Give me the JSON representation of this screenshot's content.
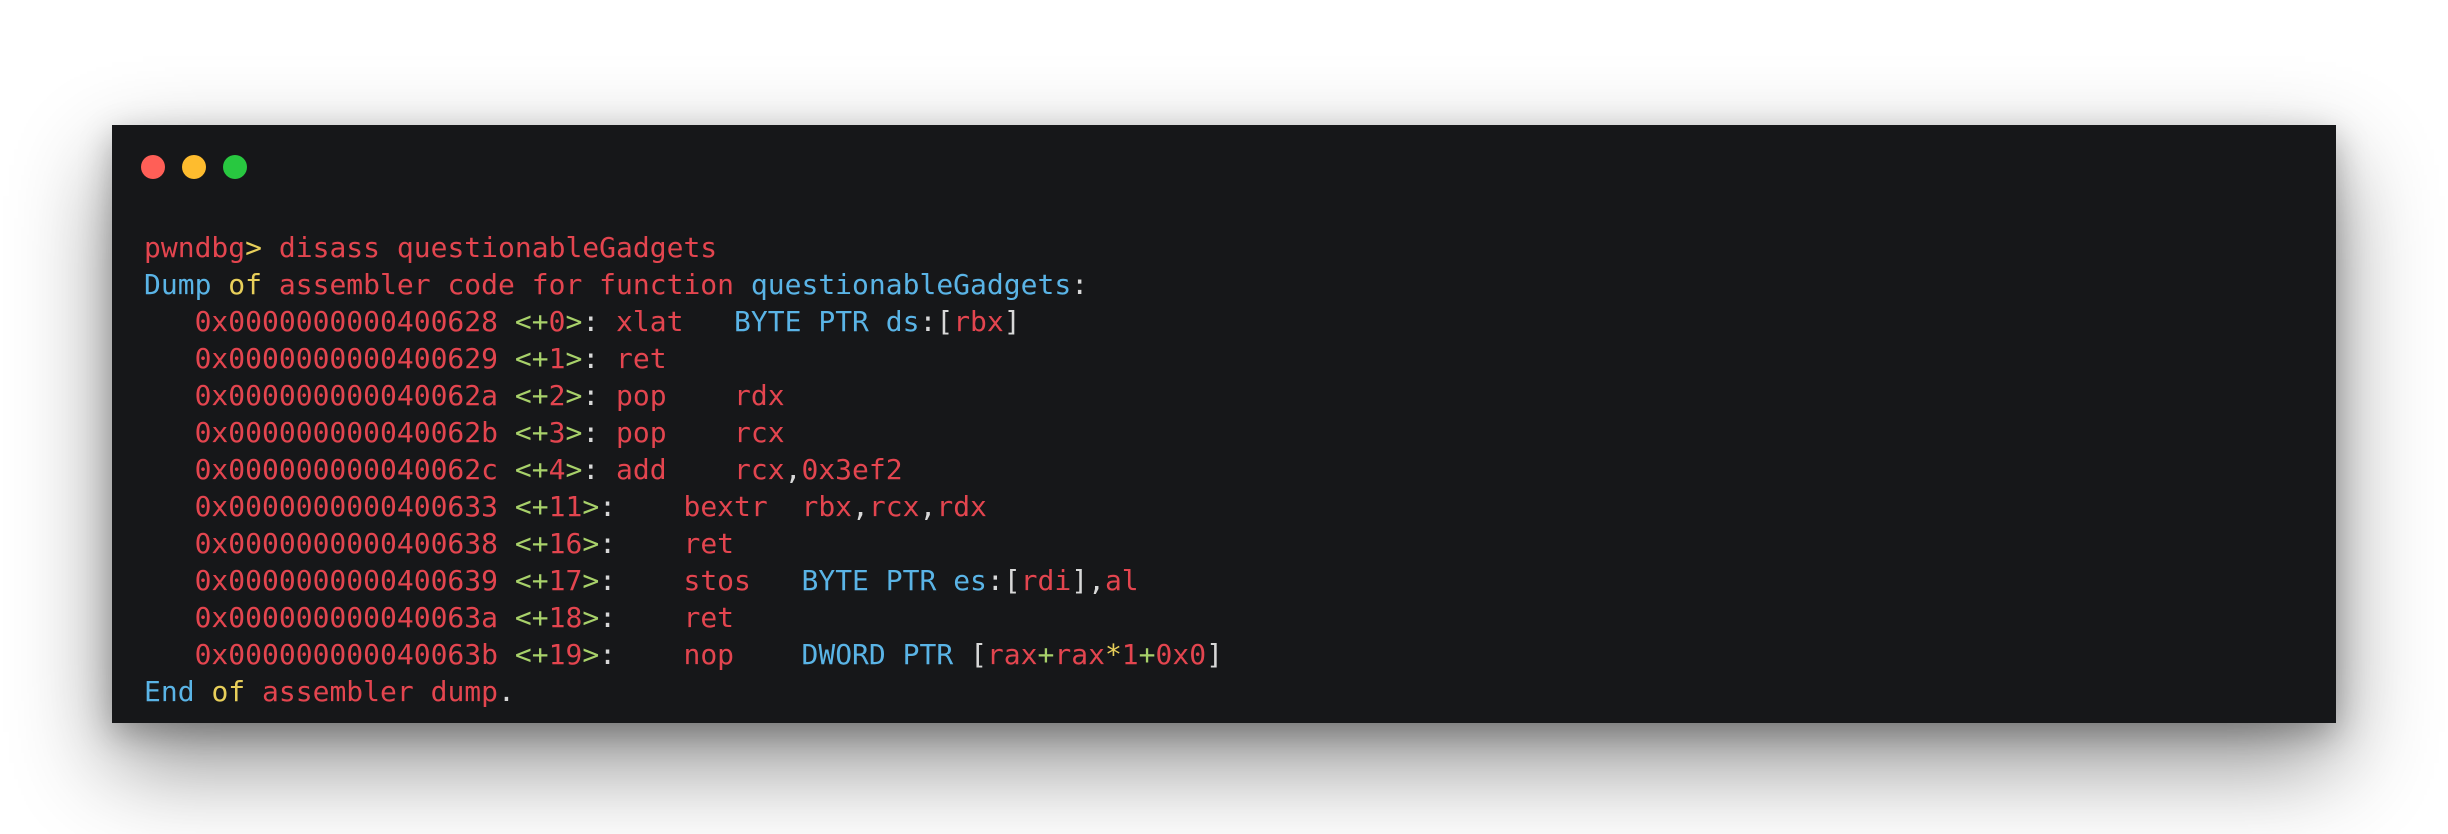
{
  "window": {
    "controls": [
      "close",
      "minimize",
      "zoom"
    ]
  },
  "colors": {
    "background": "#161719",
    "red": "#e3454f",
    "blue": "#5ab4e6",
    "yellow": "#e8cf5a",
    "green": "#a8d16a",
    "white": "#d8d8d8"
  },
  "terminal": {
    "lines": [
      [
        {
          "t": "pwndbg",
          "c": "red"
        },
        {
          "t": "> ",
          "c": "yellow"
        },
        {
          "t": "disass questionableGadgets",
          "c": "red"
        }
      ],
      [
        {
          "t": "Dump ",
          "c": "blue"
        },
        {
          "t": "of ",
          "c": "yellow"
        },
        {
          "t": "assembler code for function ",
          "c": "red"
        },
        {
          "t": "questionableGadgets",
          "c": "blue"
        },
        {
          "t": ":",
          "c": "white"
        }
      ],
      [
        {
          "t": "   0x0000000000400628 ",
          "c": "red"
        },
        {
          "t": "<+",
          "c": "green"
        },
        {
          "t": "0",
          "c": "red"
        },
        {
          "t": ">",
          "c": "green"
        },
        {
          "t": ": ",
          "c": "white"
        },
        {
          "t": "xlat   ",
          "c": "red"
        },
        {
          "t": "BYTE PTR ds",
          "c": "blue"
        },
        {
          "t": ":[",
          "c": "white"
        },
        {
          "t": "rbx",
          "c": "red"
        },
        {
          "t": "]",
          "c": "white"
        }
      ],
      [
        {
          "t": "   0x0000000000400629 ",
          "c": "red"
        },
        {
          "t": "<+",
          "c": "green"
        },
        {
          "t": "1",
          "c": "red"
        },
        {
          "t": ">",
          "c": "green"
        },
        {
          "t": ": ",
          "c": "white"
        },
        {
          "t": "ret",
          "c": "red"
        }
      ],
      [
        {
          "t": "   0x000000000040062a ",
          "c": "red"
        },
        {
          "t": "<+",
          "c": "green"
        },
        {
          "t": "2",
          "c": "red"
        },
        {
          "t": ">",
          "c": "green"
        },
        {
          "t": ": ",
          "c": "white"
        },
        {
          "t": "pop    rdx",
          "c": "red"
        }
      ],
      [
        {
          "t": "   0x000000000040062b ",
          "c": "red"
        },
        {
          "t": "<+",
          "c": "green"
        },
        {
          "t": "3",
          "c": "red"
        },
        {
          "t": ">",
          "c": "green"
        },
        {
          "t": ": ",
          "c": "white"
        },
        {
          "t": "pop    rcx",
          "c": "red"
        }
      ],
      [
        {
          "t": "   0x000000000040062c ",
          "c": "red"
        },
        {
          "t": "<+",
          "c": "green"
        },
        {
          "t": "4",
          "c": "red"
        },
        {
          "t": ">",
          "c": "green"
        },
        {
          "t": ": ",
          "c": "white"
        },
        {
          "t": "add    rcx",
          "c": "red"
        },
        {
          "t": ",",
          "c": "white"
        },
        {
          "t": "0x3ef2",
          "c": "red"
        }
      ],
      [
        {
          "t": "   0x0000000000400633 ",
          "c": "red"
        },
        {
          "t": "<+",
          "c": "green"
        },
        {
          "t": "11",
          "c": "red"
        },
        {
          "t": ">",
          "c": "green"
        },
        {
          "t": ":    ",
          "c": "white"
        },
        {
          "t": "bextr  rbx",
          "c": "red"
        },
        {
          "t": ",",
          "c": "white"
        },
        {
          "t": "rcx",
          "c": "red"
        },
        {
          "t": ",",
          "c": "white"
        },
        {
          "t": "rdx",
          "c": "red"
        }
      ],
      [
        {
          "t": "   0x0000000000400638 ",
          "c": "red"
        },
        {
          "t": "<+",
          "c": "green"
        },
        {
          "t": "16",
          "c": "red"
        },
        {
          "t": ">",
          "c": "green"
        },
        {
          "t": ":    ",
          "c": "white"
        },
        {
          "t": "ret",
          "c": "red"
        }
      ],
      [
        {
          "t": "   0x0000000000400639 ",
          "c": "red"
        },
        {
          "t": "<+",
          "c": "green"
        },
        {
          "t": "17",
          "c": "red"
        },
        {
          "t": ">",
          "c": "green"
        },
        {
          "t": ":    ",
          "c": "white"
        },
        {
          "t": "stos   ",
          "c": "red"
        },
        {
          "t": "BYTE PTR es",
          "c": "blue"
        },
        {
          "t": ":[",
          "c": "white"
        },
        {
          "t": "rdi",
          "c": "red"
        },
        {
          "t": "],",
          "c": "white"
        },
        {
          "t": "al",
          "c": "red"
        }
      ],
      [
        {
          "t": "   0x000000000040063a ",
          "c": "red"
        },
        {
          "t": "<+",
          "c": "green"
        },
        {
          "t": "18",
          "c": "red"
        },
        {
          "t": ">",
          "c": "green"
        },
        {
          "t": ":    ",
          "c": "white"
        },
        {
          "t": "ret",
          "c": "red"
        }
      ],
      [
        {
          "t": "   0x000000000040063b ",
          "c": "red"
        },
        {
          "t": "<+",
          "c": "green"
        },
        {
          "t": "19",
          "c": "red"
        },
        {
          "t": ">",
          "c": "green"
        },
        {
          "t": ":    ",
          "c": "white"
        },
        {
          "t": "nop    ",
          "c": "red"
        },
        {
          "t": "DWORD PTR ",
          "c": "blue"
        },
        {
          "t": "[",
          "c": "white"
        },
        {
          "t": "rax",
          "c": "red"
        },
        {
          "t": "+",
          "c": "green"
        },
        {
          "t": "rax",
          "c": "red"
        },
        {
          "t": "*",
          "c": "yellow"
        },
        {
          "t": "1",
          "c": "red"
        },
        {
          "t": "+",
          "c": "green"
        },
        {
          "t": "0x0",
          "c": "red"
        },
        {
          "t": "]",
          "c": "white"
        }
      ],
      [
        {
          "t": "End ",
          "c": "blue"
        },
        {
          "t": "of ",
          "c": "yellow"
        },
        {
          "t": "assembler dump",
          "c": "red"
        },
        {
          "t": ".",
          "c": "white"
        }
      ]
    ]
  }
}
